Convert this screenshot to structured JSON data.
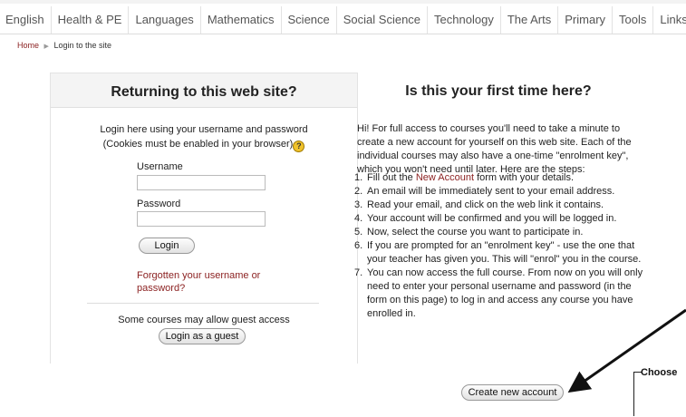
{
  "nav": {
    "items": [
      "English",
      "Health & PE",
      "Languages",
      "Mathematics",
      "Science",
      "Social Science",
      "Technology",
      "The Arts",
      "Primary",
      "Tools",
      "Links"
    ]
  },
  "breadcrumb": {
    "home": "Home",
    "separator": "▶",
    "current": "Login to the site"
  },
  "login": {
    "heading": "Returning to this web site?",
    "desc_line1": "Login here using your username and password",
    "desc_line2": "(Cookies must be enabled in your browser)",
    "help_glyph": "?",
    "username_label": "Username",
    "username_value": "",
    "password_label": "Password",
    "password_value": "",
    "login_button": "Login",
    "forgot_link": "Forgotten your username or password?",
    "guest_note": "Some courses may allow guest access",
    "guest_button": "Login as a guest"
  },
  "signup": {
    "heading": "Is this your first time here?",
    "intro": "Hi! For full access to courses you'll need to take a minute to create a new account for yourself on this web site. Each of the individual courses may also have a one-time \"enrolment key\", which you won't need until later. Here are the steps:",
    "step1_pre": "Fill out the ",
    "step1_link": "New Account",
    "step1_post": " form with your details.",
    "steps": [
      "An email will be immediately sent to your email address.",
      "Read your email, and click on the web link it contains.",
      "Your account will be confirmed and you will be logged in.",
      "Now, select the course you want to participate in.",
      "If you are prompted for an \"enrolment key\" - use the one that your teacher has given you. This will \"enrol\" you in the course.",
      "You can now access the full course. From now on you will only need to enter your personal username and password (in the form on this page) to log in and access any course you have enrolled in."
    ],
    "create_button": "Create new account"
  },
  "annotation": {
    "choose_label": "Choose",
    "arrow_color": "#111111"
  },
  "colors": {
    "link": "#8a1f1f",
    "help_icon": "#f0c22b",
    "box_header_bg": "#f4f4f4"
  }
}
